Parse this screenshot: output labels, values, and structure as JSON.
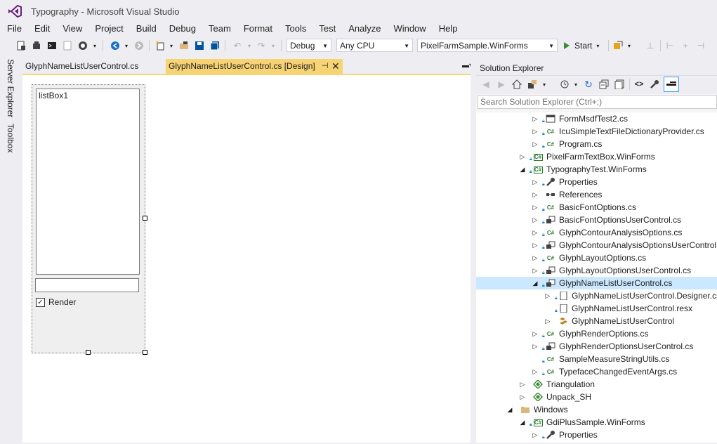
{
  "window": {
    "title": "Typography - Microsoft Visual Studio"
  },
  "menu": [
    "File",
    "Edit",
    "View",
    "Project",
    "Build",
    "Debug",
    "Team",
    "Format",
    "Tools",
    "Test",
    "Analyze",
    "Window",
    "Help"
  ],
  "toolbar": {
    "config": "Debug",
    "platform": "Any CPU",
    "startup_project": "PixelFarmSample.WinForms",
    "start_label": "Start"
  },
  "left_rail": {
    "tabs": [
      "Server Explorer",
      "Toolbox"
    ]
  },
  "document_tabs": [
    {
      "label": "GlyphNameListUserControl.cs",
      "active": false
    },
    {
      "label": "GlyphNameListUserControl.cs [Design]",
      "active": true
    }
  ],
  "designer": {
    "listbox_text": "listBox1",
    "checkbox_label": "Render",
    "checkbox_checked": true
  },
  "solution_explorer": {
    "title": "Solution Explorer",
    "search_placeholder": "Search Solution Explorer (Ctrl+;)",
    "items": [
      {
        "label": "FormMsdfTest2.cs",
        "icon": "form",
        "level": 3,
        "expander": "collapsed",
        "lock": true
      },
      {
        "label": "IcuSimpleTextFileDictionaryProvider.cs",
        "icon": "cs",
        "level": 3,
        "expander": "collapsed",
        "lock": true
      },
      {
        "label": "Program.cs",
        "icon": "cs",
        "level": 3,
        "expander": "collapsed",
        "lock": true
      },
      {
        "label": "PixelFarmTextBox.WinForms",
        "icon": "csproj",
        "level": 2,
        "expander": "collapsed",
        "lock": true
      },
      {
        "label": "TypographyTest.WinForms",
        "icon": "csproj",
        "level": 2,
        "expander": "expanded",
        "lock": true
      },
      {
        "label": "Properties",
        "icon": "wrench",
        "level": 3,
        "expander": "collapsed",
        "lock": true
      },
      {
        "label": "References",
        "icon": "refs",
        "level": 3,
        "expander": "collapsed",
        "lock": false
      },
      {
        "label": "BasicFontOptions.cs",
        "icon": "cs",
        "level": 3,
        "expander": "collapsed",
        "lock": true
      },
      {
        "label": "BasicFontOptionsUserControl.cs",
        "icon": "usercontrol",
        "level": 3,
        "expander": "collapsed",
        "lock": true
      },
      {
        "label": "GlyphContourAnalysisOptions.cs",
        "icon": "cs",
        "level": 3,
        "expander": "collapsed",
        "lock": true
      },
      {
        "label": "GlyphContourAnalysisOptionsUserControl.cs",
        "icon": "usercontrol",
        "level": 3,
        "expander": "collapsed",
        "lock": true
      },
      {
        "label": "GlyphLayoutOptions.cs",
        "icon": "cs",
        "level": 3,
        "expander": "collapsed",
        "lock": true
      },
      {
        "label": "GlyphLayoutOptionsUserControl.cs",
        "icon": "usercontrol",
        "level": 3,
        "expander": "collapsed",
        "lock": true
      },
      {
        "label": "GlyphNameListUserControl.cs",
        "icon": "usercontrol",
        "level": 3,
        "expander": "expanded",
        "lock": true,
        "selected": true
      },
      {
        "label": "GlyphNameListUserControl.Designer.cs",
        "icon": "file",
        "level": 4,
        "expander": "collapsed",
        "lock": true
      },
      {
        "label": "GlyphNameListUserControl.resx",
        "icon": "file",
        "level": 4,
        "expander": "none",
        "lock": true
      },
      {
        "label": "GlyphNameListUserControl",
        "icon": "class",
        "level": 4,
        "expander": "collapsed",
        "lock": false
      },
      {
        "label": "GlyphRenderOptions.cs",
        "icon": "cs",
        "level": 3,
        "expander": "collapsed",
        "lock": true
      },
      {
        "label": "GlyphRenderOptionsUserControl.cs",
        "icon": "usercontrol",
        "level": 3,
        "expander": "collapsed",
        "lock": true
      },
      {
        "label": "SampleMeasureStringUtils.cs",
        "icon": "cs",
        "level": 3,
        "expander": "none",
        "lock": true
      },
      {
        "label": "TypefaceChangedEventArgs.cs",
        "icon": "cs",
        "level": 3,
        "expander": "collapsed",
        "lock": true
      },
      {
        "label": "Triangulation",
        "icon": "shared",
        "level": 2,
        "expander": "collapsed",
        "lock": false
      },
      {
        "label": "Unpack_SH",
        "icon": "shared",
        "level": 2,
        "expander": "collapsed",
        "lock": false
      },
      {
        "label": "Windows",
        "icon": "folder",
        "level": 1,
        "expander": "expanded",
        "lock": false
      },
      {
        "label": "GdiPlusSample.WinForms",
        "icon": "csproj",
        "level": 2,
        "expander": "expanded",
        "lock": true
      },
      {
        "label": "Properties",
        "icon": "wrench",
        "level": 3,
        "expander": "collapsed",
        "lock": true
      }
    ]
  }
}
